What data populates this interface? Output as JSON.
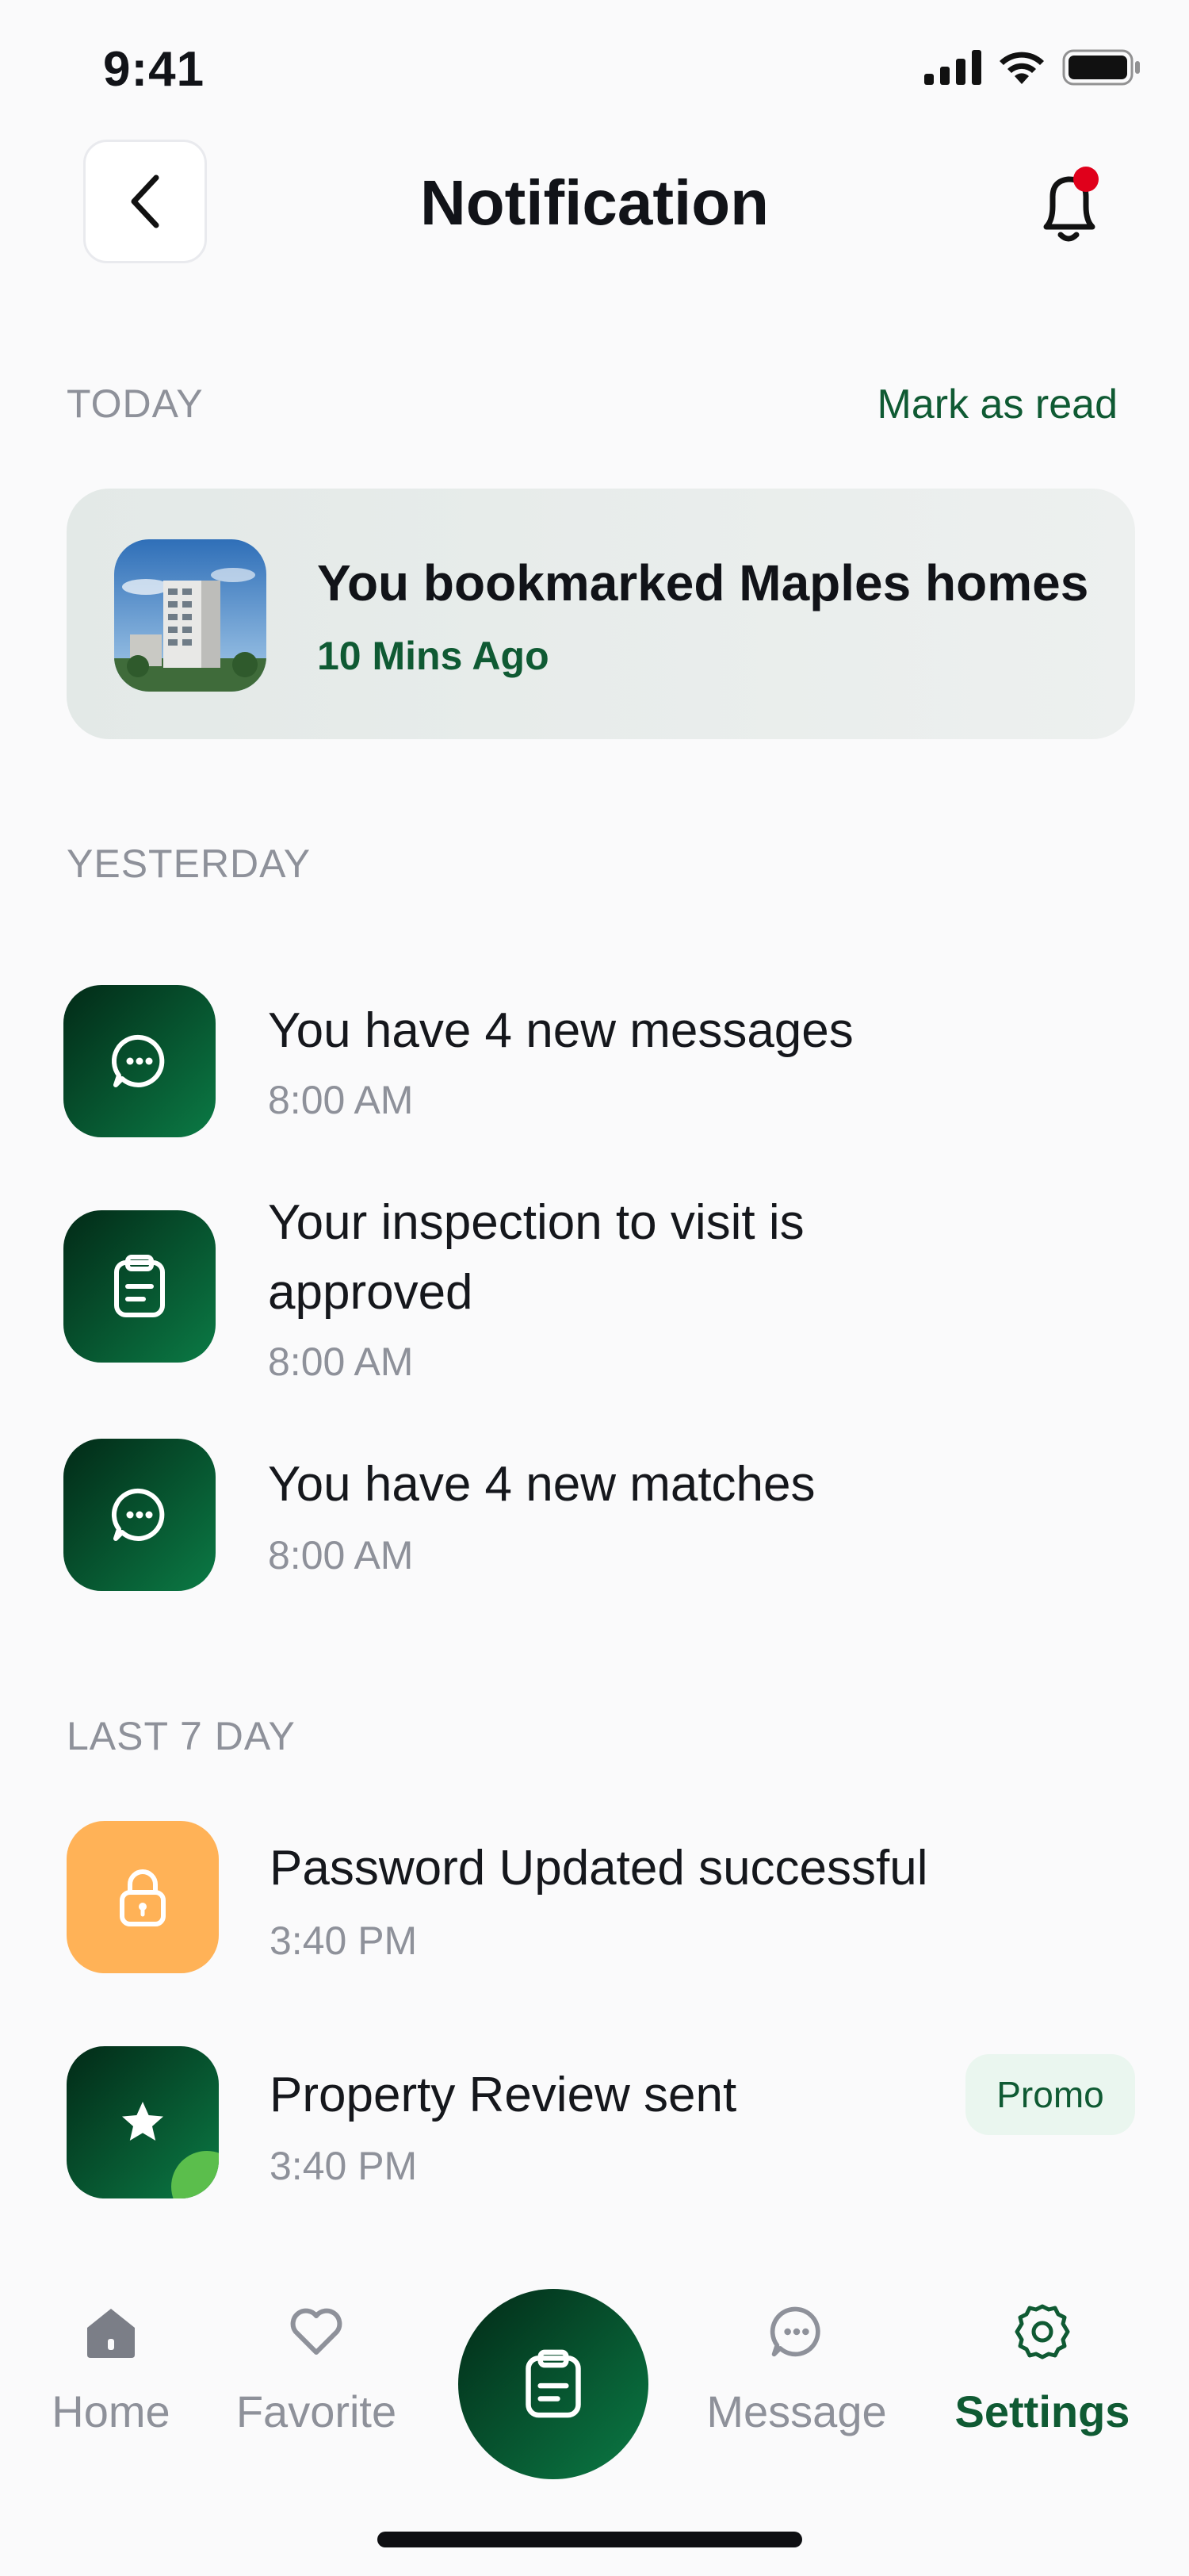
{
  "status_bar": {
    "time": "9:41"
  },
  "header": {
    "title": "Notification"
  },
  "sections": {
    "today": {
      "label": "TODAY",
      "action": "Mark as read"
    },
    "yesterday": {
      "label": "YESTERDAY"
    },
    "last7": {
      "label": "LAST 7 DAY"
    }
  },
  "today_card": {
    "title": "You bookmarked Maples homes",
    "time": "10 Mins Ago"
  },
  "yesterday_items": [
    {
      "title": "You have 4 new messages",
      "time": "8:00 AM",
      "icon": "chat-icon"
    },
    {
      "title_line1": "Your inspection to visit is",
      "title_line2": "approved",
      "time": "8:00 AM",
      "icon": "clipboard-icon"
    },
    {
      "title": "You have 4 new matches",
      "time": "8:00 AM",
      "icon": "chat-icon"
    }
  ],
  "last7_items": [
    {
      "title": "Password Updated successful",
      "time": "3:40 PM",
      "icon": "lock-icon"
    },
    {
      "title": "Property Review sent",
      "time": "3:40 PM",
      "icon": "star-icon",
      "badge": "Promo"
    }
  ],
  "tabbar": {
    "home": "Home",
    "favorite": "Favorite",
    "message": "Message",
    "settings": "Settings",
    "active": "settings"
  },
  "colors": {
    "brand_green": "#0F5A33",
    "gradient_dark": "#022A17",
    "gradient_light": "#0B7A45",
    "orange": "#FFB257",
    "notification_dot": "#E0001B"
  }
}
